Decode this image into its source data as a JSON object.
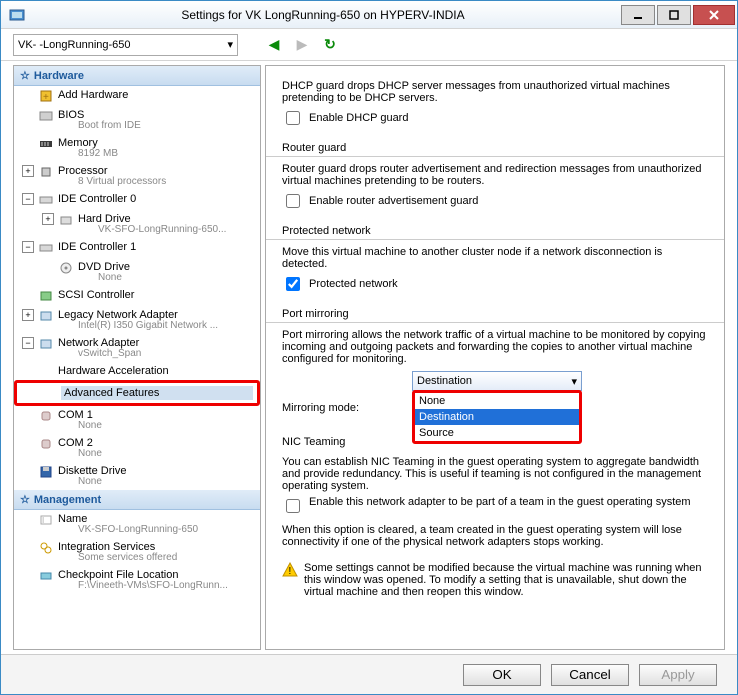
{
  "title": "Settings for VK       LongRunning-650 on HYPERV-INDIA",
  "vm_selector": "VK-      -LongRunning-650",
  "tree": {
    "hardware_header": "Hardware",
    "add_hardware": "Add Hardware",
    "bios": "BIOS",
    "bios_sub": "Boot from IDE",
    "memory": "Memory",
    "memory_sub": "8192 MB",
    "processor": "Processor",
    "processor_sub": "8 Virtual processors",
    "ide0": "IDE Controller 0",
    "hard_drive": "Hard Drive",
    "hard_drive_sub": "VK-SFO-LongRunning-650...",
    "ide1": "IDE Controller 1",
    "dvd": "DVD Drive",
    "dvd_sub": "None",
    "scsi": "SCSI Controller",
    "legacy_na": "Legacy Network Adapter",
    "legacy_na_sub": "Intel(R) I350 Gigabit Network ...",
    "na": "Network Adapter",
    "na_sub": "vSwitch_Span",
    "hw_accel": "Hardware Acceleration",
    "adv_feat": "Advanced Features",
    "com1": "COM 1",
    "com1_sub": "None",
    "com2": "COM 2",
    "com2_sub": "None",
    "diskette": "Diskette Drive",
    "diskette_sub": "None",
    "mgmt_header": "Management",
    "name": "Name",
    "name_sub": "VK-SFO-LongRunning-650",
    "integ": "Integration Services",
    "integ_sub": "Some services offered",
    "checkpoint": "Checkpoint File Location",
    "checkpoint_sub": "F:\\Vineeth-VMs\\SFO-LongRunn..."
  },
  "panel": {
    "dhcp_desc": "DHCP guard drops DHCP server messages from unauthorized virtual machines pretending to be DHCP servers.",
    "dhcp_chk": "Enable DHCP guard",
    "router_title": "Router guard",
    "router_desc": "Router guard drops router advertisement and redirection messages from unauthorized virtual machines pretending to be routers.",
    "router_chk": "Enable router advertisement guard",
    "protected_title": "Protected network",
    "protected_desc": "Move this virtual machine to another cluster node if a network disconnection is detected.",
    "protected_chk": "Protected network",
    "mirror_title": "Port mirroring",
    "mirror_desc": "Port mirroring allows the network traffic of a virtual machine to be monitored by copying incoming and outgoing packets and forwarding the copies to another virtual machine configured for monitoring.",
    "mirror_label": "Mirroring mode:",
    "mirror_value": "Destination",
    "mirror_options": {
      "none": "None",
      "dest": "Destination",
      "src": "Source"
    },
    "nic_title": "NIC Teaming",
    "nic_desc": "You can establish NIC Teaming in the guest operating system to aggregate bandwidth and provide redundancy. This is useful if teaming is not configured in the management operating system.",
    "nic_chk": "Enable this network adapter to be part of a team in the guest operating system",
    "nic_note": "When this option is cleared, a team created in the guest operating system will lose connectivity if one of the physical network adapters stops working.",
    "warn": "Some settings cannot be modified because the virtual machine was running when this window was opened. To modify a setting that is unavailable, shut down the virtual machine and then reopen this window."
  },
  "buttons": {
    "ok": "OK",
    "cancel": "Cancel",
    "apply": "Apply"
  }
}
